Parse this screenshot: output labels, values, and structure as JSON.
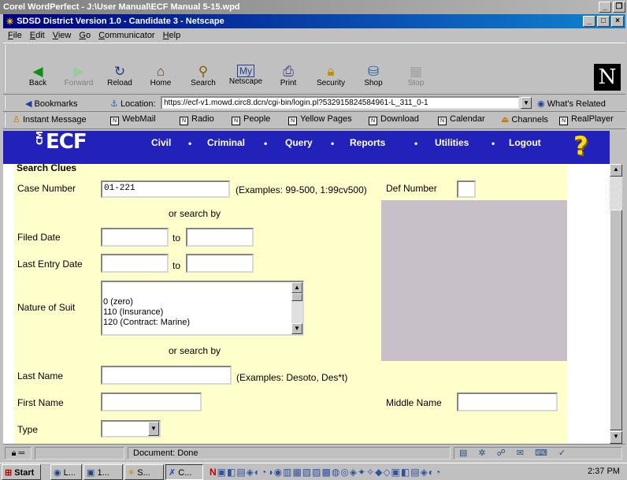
{
  "wp_window": {
    "title": "Corel WordPerfect - J:\\User Manual\\ECF Manual 5-15.wpd"
  },
  "ns_window": {
    "title": "SDSD District Version 1.0 - Candidate 3 - Netscape"
  },
  "menu": [
    "File",
    "Edit",
    "View",
    "Go",
    "Communicator",
    "Help"
  ],
  "nav": {
    "back": "Back",
    "forward": "Forward",
    "reload": "Reload",
    "home": "Home",
    "search": "Search",
    "netscape": "Netscape",
    "print": "Print",
    "security": "Security",
    "shop": "Shop",
    "stop": "Stop"
  },
  "location": {
    "bookmarks": "Bookmarks",
    "label": "Location:",
    "url": "https://ecf-v1.mowd.circ8.dcn/cgi-bin/login.pl?532915824584961-L_311_0-1",
    "whats_related": "What's Related"
  },
  "personal": [
    "Instant Message",
    "WebMail",
    "Radio",
    "People",
    "Yellow Pages",
    "Download",
    "Calendar",
    "Channels",
    "RealPlayer"
  ],
  "ecf": {
    "logo": "ECF",
    "logo_small": "CM",
    "menu": [
      "Civil",
      "Criminal",
      "Query",
      "Reports",
      "Utilities",
      "Logout"
    ],
    "help": "?"
  },
  "form": {
    "heading": "Search Clues",
    "case_number_label": "Case Number",
    "case_number_value": "01-221",
    "case_examples": "(Examples: 99-500, 1:99cv500)",
    "def_number_label": "Def Number",
    "def_number_value": "",
    "or_search_by": "or search by",
    "filed_date_label": "Filed Date",
    "last_entry_label": "Last Entry Date",
    "to": "to",
    "nature_label": "Nature of Suit",
    "nature_options": [
      "0 (zero)",
      "110 (Insurance)",
      "120 (Contract: Marine)"
    ],
    "last_name_label": "Last Name",
    "last_name_value": "",
    "last_name_examples": "(Examples: Desoto, Des*t)",
    "first_name_label": "First Name",
    "first_name_value": "",
    "middle_name_label": "Middle Name",
    "middle_name_value": "",
    "type_label": "Type",
    "type_value": ""
  },
  "status": {
    "text": "Document: Done"
  },
  "taskbar": {
    "start": "Start",
    "tasks": [
      "L...",
      "1...",
      "S...",
      "C..."
    ],
    "tray_label": "N",
    "time": "2:37 PM"
  },
  "colors": {
    "ecf_bar": "#2222bb",
    "form_bg": "#ffffcc",
    "title_active": "#000080",
    "title_inactive": "#808080"
  }
}
